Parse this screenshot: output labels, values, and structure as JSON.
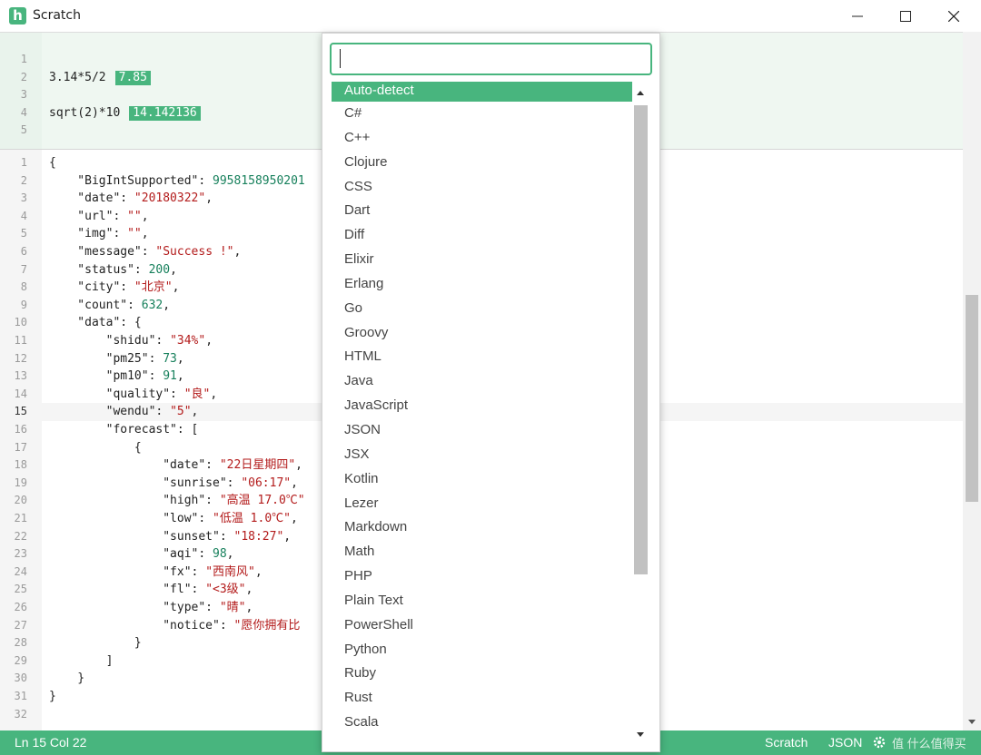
{
  "window": {
    "logo_letter": "h",
    "title": "Scratch"
  },
  "math_lines": [
    {
      "num": "1",
      "expr": "",
      "result": ""
    },
    {
      "num": "2",
      "expr": "3.14*5/2",
      "result": "7.85"
    },
    {
      "num": "3",
      "expr": "",
      "result": ""
    },
    {
      "num": "4",
      "expr": "sqrt(2)*10",
      "result": "14.142136"
    },
    {
      "num": "5",
      "expr": "",
      "result": ""
    }
  ],
  "json_lines": [
    {
      "num": "1",
      "text": "{"
    },
    {
      "num": "2",
      "key": "    \"BigIntSupported\": ",
      "value": "9958158950201",
      "vtype": "n",
      "tail": ""
    },
    {
      "num": "3",
      "key": "    \"date\": ",
      "value": "\"20180322\"",
      "vtype": "s",
      "tail": ","
    },
    {
      "num": "4",
      "key": "    \"url\": ",
      "value": "\"\"",
      "vtype": "s",
      "tail": ","
    },
    {
      "num": "5",
      "key": "    \"img\": ",
      "value": "\"\"",
      "vtype": "s",
      "tail": ","
    },
    {
      "num": "6",
      "key": "    \"message\": ",
      "value": "\"Success !\"",
      "vtype": "s",
      "tail": ","
    },
    {
      "num": "7",
      "key": "    \"status\": ",
      "value": "200",
      "vtype": "n",
      "tail": ","
    },
    {
      "num": "8",
      "key": "    \"city\": ",
      "value": "\"北京\"",
      "vtype": "s",
      "tail": ","
    },
    {
      "num": "9",
      "key": "    \"count\": ",
      "value": "632",
      "vtype": "n",
      "tail": ","
    },
    {
      "num": "10",
      "text": "    \"data\": {"
    },
    {
      "num": "11",
      "key": "        \"shidu\": ",
      "value": "\"34%\"",
      "vtype": "s",
      "tail": ","
    },
    {
      "num": "12",
      "key": "        \"pm25\": ",
      "value": "73",
      "vtype": "n",
      "tail": ","
    },
    {
      "num": "13",
      "key": "        \"pm10\": ",
      "value": "91",
      "vtype": "n",
      "tail": ","
    },
    {
      "num": "14",
      "key": "        \"quality\": ",
      "value": "\"良\"",
      "vtype": "s",
      "tail": ","
    },
    {
      "num": "15",
      "key": "        \"wendu\": ",
      "value": "\"5\"",
      "vtype": "s",
      "tail": ","
    },
    {
      "num": "16",
      "text": "        \"forecast\": ["
    },
    {
      "num": "17",
      "text": "            {"
    },
    {
      "num": "18",
      "key": "                \"date\": ",
      "value": "\"22日星期四\"",
      "vtype": "s",
      "tail": ","
    },
    {
      "num": "19",
      "key": "                \"sunrise\": ",
      "value": "\"06:17\"",
      "vtype": "s",
      "tail": ","
    },
    {
      "num": "20",
      "key": "                \"high\": ",
      "value": "\"高温 17.0℃\"",
      "vtype": "s",
      "tail": ""
    },
    {
      "num": "21",
      "key": "                \"low\": ",
      "value": "\"低温 1.0℃\"",
      "vtype": "s",
      "tail": ","
    },
    {
      "num": "22",
      "key": "                \"sunset\": ",
      "value": "\"18:27\"",
      "vtype": "s",
      "tail": ","
    },
    {
      "num": "23",
      "key": "                \"aqi\": ",
      "value": "98",
      "vtype": "n",
      "tail": ","
    },
    {
      "num": "24",
      "key": "                \"fx\": ",
      "value": "\"西南风\"",
      "vtype": "s",
      "tail": ","
    },
    {
      "num": "25",
      "key": "                \"fl\": ",
      "value": "\"<3级\"",
      "vtype": "s",
      "tail": ","
    },
    {
      "num": "26",
      "key": "                \"type\": ",
      "value": "\"晴\"",
      "vtype": "s",
      "tail": ","
    },
    {
      "num": "27",
      "key": "                \"notice\": ",
      "value": "\"愿你拥有比",
      "vtype": "s",
      "tail": ""
    },
    {
      "num": "28",
      "text": "            }"
    },
    {
      "num": "29",
      "text": "        ]"
    },
    {
      "num": "30",
      "text": "    }"
    },
    {
      "num": "31",
      "text": "}"
    },
    {
      "num": "32",
      "text": ""
    }
  ],
  "active_json_line": "15",
  "dropdown": {
    "search_value": "",
    "selected": "Auto-detect",
    "items": [
      "Auto-detect",
      "C#",
      "C++",
      "Clojure",
      "CSS",
      "Dart",
      "Diff",
      "Elixir",
      "Erlang",
      "Go",
      "Groovy",
      "HTML",
      "Java",
      "JavaScript",
      "JSON",
      "JSX",
      "Kotlin",
      "Lezer",
      "Markdown",
      "Math",
      "PHP",
      "Plain Text",
      "PowerShell",
      "Python",
      "Ruby",
      "Rust",
      "Scala"
    ]
  },
  "statusbar": {
    "position": "Ln 15 Col 22",
    "mode": "Scratch",
    "language": "JSON",
    "watermark": "值 什么值得买"
  },
  "colors": {
    "accent": "#48b57e",
    "string": "#b31b1b",
    "number": "#17805c"
  },
  "icons": {
    "logo": "heynote-logo-icon",
    "minimize": "minimize-icon",
    "maximize": "maximize-icon",
    "close": "close-icon",
    "settings": "gear-icon"
  }
}
